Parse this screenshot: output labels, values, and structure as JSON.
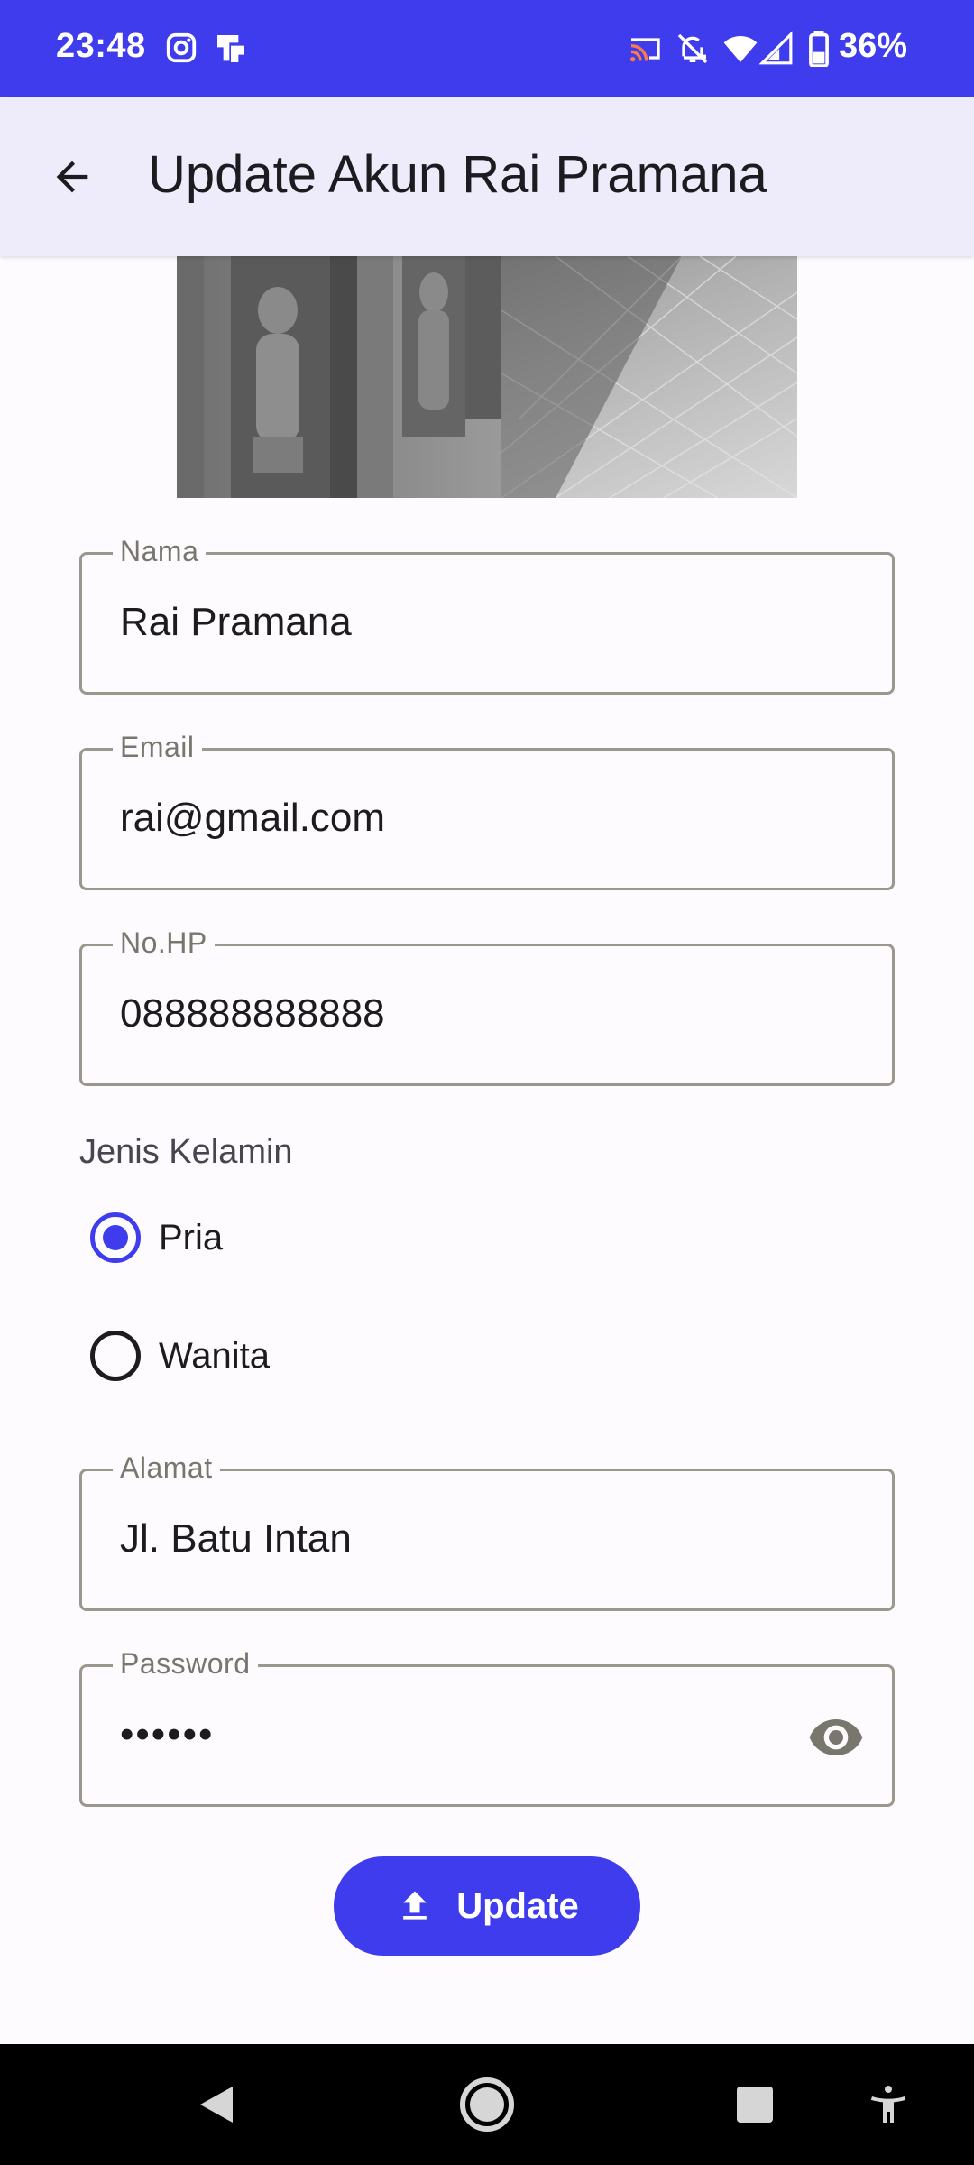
{
  "status_bar": {
    "time": "23:48",
    "battery": "36%",
    "icons": [
      "instagram-icon",
      "notification-app-icon",
      "cast-icon",
      "bell-off-icon",
      "wifi-icon",
      "signal-icon",
      "battery-icon"
    ],
    "color": "#3f3cee"
  },
  "app_bar": {
    "title": "Update Akun Rai Pramana",
    "back_icon": "arrow-back-icon"
  },
  "form": {
    "nama": {
      "label": "Nama",
      "value": "Rai Pramana"
    },
    "email": {
      "label": "Email",
      "value": "rai@gmail.com"
    },
    "phone": {
      "label": "No.HP",
      "value": "088888888888"
    },
    "gender": {
      "label": "Jenis Kelamin",
      "options": [
        {
          "label": "Pria",
          "selected": true
        },
        {
          "label": "Wanita",
          "selected": false
        }
      ]
    },
    "alamat": {
      "label": "Alamat",
      "value": "Jl. Batu Intan"
    },
    "password": {
      "label": "Password",
      "value": "••••••",
      "toggle_icon": "eye-icon"
    }
  },
  "update_button": {
    "label": "Update",
    "icon": "upload-icon"
  },
  "nav_bar": {
    "items": [
      "back-triangle-icon",
      "home-circle-icon",
      "recents-square-icon",
      "accessibility-icon"
    ]
  },
  "colors": {
    "primary": "#3f3cee",
    "app_bar_bg": "#eeebfb",
    "background": "#fefbff",
    "outline": "#9b978d"
  }
}
